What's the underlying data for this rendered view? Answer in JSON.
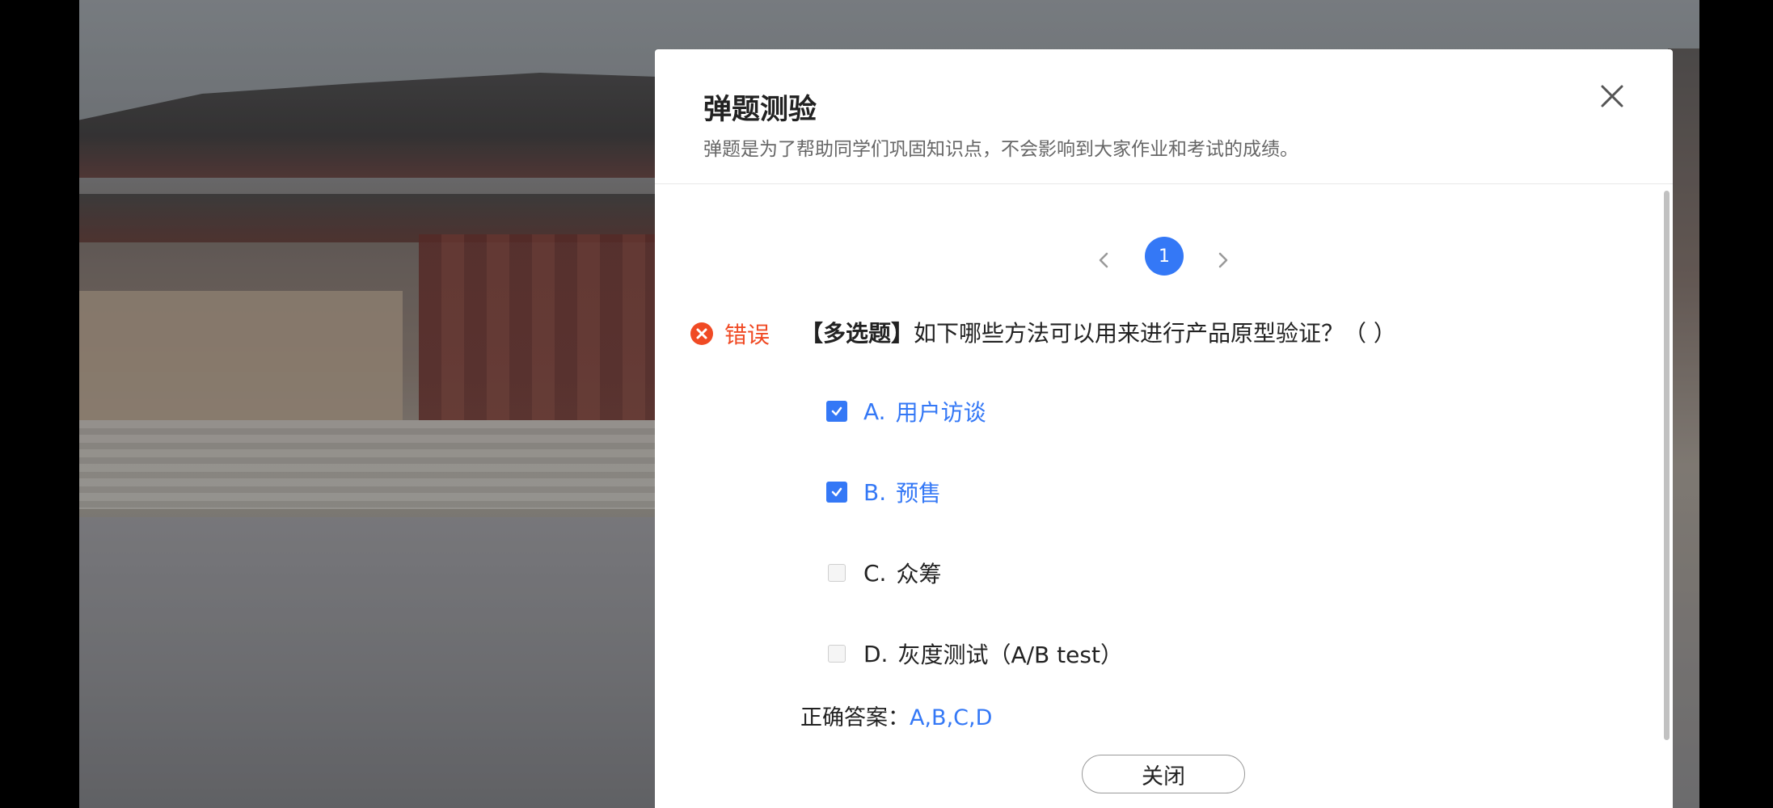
{
  "watermark": "",
  "modal": {
    "title": "弹题测验",
    "subtitle": "弹题是为了帮助同学们巩固知识点，不会影响到大家作业和考试的成绩。"
  },
  "pager": {
    "current_page": "1"
  },
  "result": {
    "label": "错误",
    "status_color": "#f04a24"
  },
  "question": {
    "type_label": "【多选题】",
    "text": "如下哪些方法可以用来进行产品原型验证？（ ）"
  },
  "options": [
    {
      "letter": "A.",
      "text": "用户访谈",
      "checked": true
    },
    {
      "letter": "B.",
      "text": "预售",
      "checked": true
    },
    {
      "letter": "C.",
      "text": "众筹",
      "checked": false
    },
    {
      "letter": "D.",
      "text": "灰度测试（A/B test）",
      "checked": false
    }
  ],
  "answer": {
    "label": "正确答案：",
    "value": "A,B,C,D"
  },
  "footer": {
    "close_label": "关闭"
  },
  "colors": {
    "accent": "#3478f6",
    "error": "#f04a24"
  }
}
